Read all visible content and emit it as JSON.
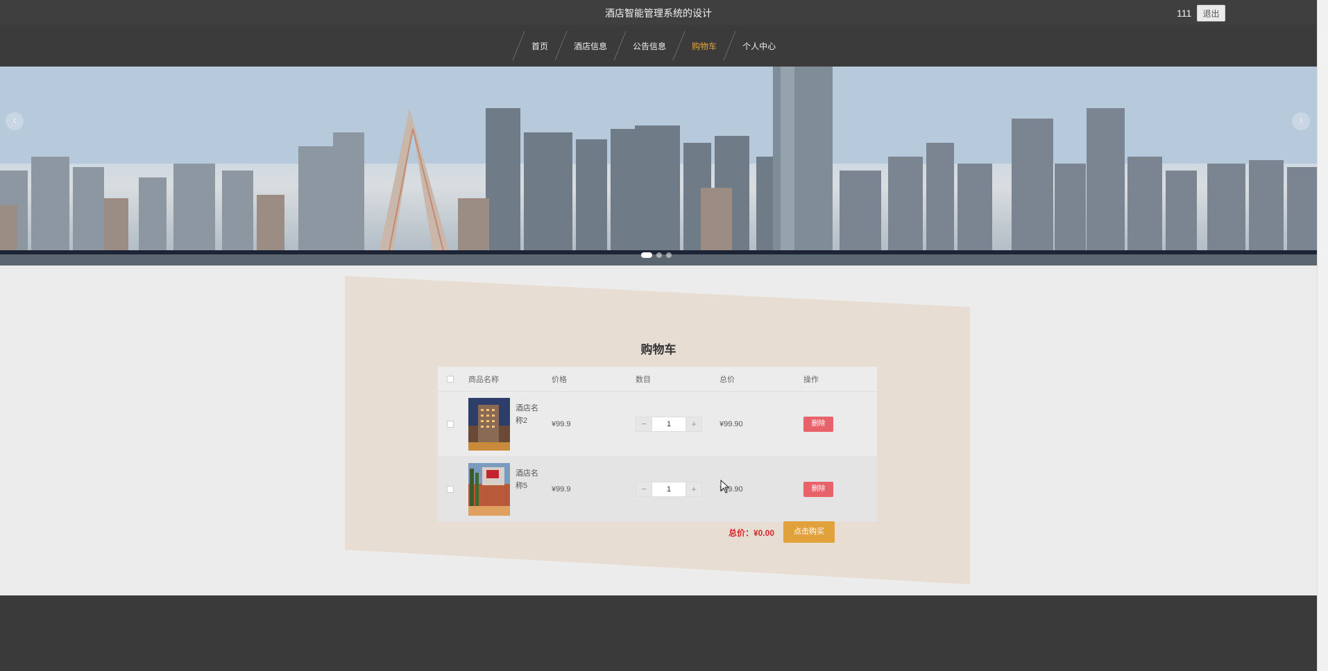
{
  "header": {
    "site_title": "酒店智能管理系统的设计",
    "username": "111",
    "logout_label": "退出"
  },
  "nav": {
    "items": [
      {
        "label": "首页"
      },
      {
        "label": "酒店信息"
      },
      {
        "label": "公告信息"
      },
      {
        "label": "购物车"
      },
      {
        "label": "个人中心"
      }
    ],
    "active": "购物车"
  },
  "banner": {
    "prev_icon": "‹",
    "next_icon": "›",
    "slide_count": 3,
    "active_slide": 1
  },
  "cart": {
    "title": "购物车",
    "columns": {
      "name": "商品名称",
      "price": "价格",
      "qty": "数目",
      "total": "总价",
      "op": "操作"
    },
    "items": [
      {
        "name": "酒店名称2",
        "price": "¥99.9",
        "qty": "1",
        "total": "¥99.90",
        "delete_label": "删除"
      },
      {
        "name": "酒店名称5",
        "price": "¥99.9",
        "qty": "1",
        "total": "¥99.90",
        "delete_label": "删除"
      }
    ],
    "minus": "−",
    "plus": "+",
    "total_label": "总价：¥0.00",
    "buy_label": "点击购买"
  },
  "colors": {
    "accent": "#e6a23c",
    "delete": "#e8626a",
    "total_text": "#d9242c",
    "nav_bg": "#3b3b3b"
  }
}
